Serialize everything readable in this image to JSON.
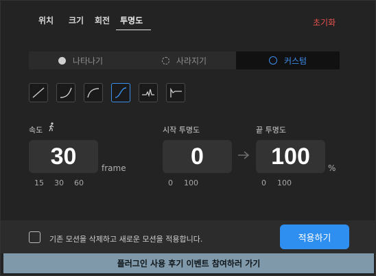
{
  "tabs": [
    "위치",
    "크기",
    "회전",
    "투명도"
  ],
  "active_tab": "투명도",
  "reset_label": "초기화",
  "motion_modes": [
    {
      "label": "나타나기",
      "icon": "filled-circle-icon"
    },
    {
      "label": "사라지기",
      "icon": "dashed-circle-icon"
    },
    {
      "label": "커스텀",
      "icon": "ring-icon"
    }
  ],
  "active_mode": "커스텀",
  "easing_presets": [
    "linear",
    "ease-in",
    "ease-out",
    "ease-in-out",
    "bounce",
    "elastic"
  ],
  "active_easing": "ease-in-out",
  "speed": {
    "label": "속도",
    "icon": "walking-person-icon",
    "value": "30",
    "unit": "frame",
    "presets": [
      "15",
      "30",
      "60"
    ]
  },
  "start_opacity": {
    "label": "시작 투명도",
    "value": "0",
    "presets": [
      "0",
      "100"
    ]
  },
  "end_opacity": {
    "label": "끝 투명도",
    "value": "100",
    "unit": "%",
    "presets": [
      "0",
      "100"
    ]
  },
  "replace_checkbox": {
    "label": "기존 모션을 삭제하고 새로운 모션을 적용합니다.",
    "checked": false
  },
  "apply_label": "적용하기",
  "banner_label": "플러그인 사용 후기 이벤트 참여하러 가기",
  "colors": {
    "accent": "#2f8ff0",
    "reset": "#e8534f",
    "banner": "#7f99aa"
  }
}
